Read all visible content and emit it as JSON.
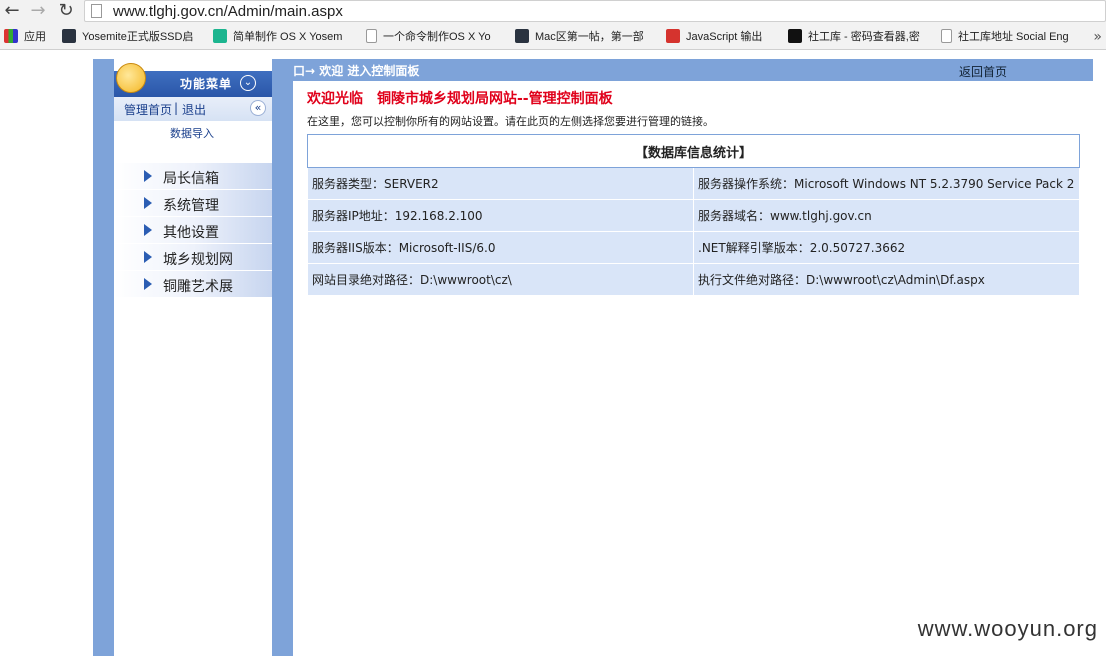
{
  "browser": {
    "url": "www.tlghj.gov.cn/Admin/main.aspx",
    "bookmarks": [
      {
        "label": "应用",
        "icon": "apps-grid-icon"
      },
      {
        "label": "Yosemite正式版SSD启",
        "icon": "app-icon"
      },
      {
        "label": "简单制作 OS X Yosem",
        "icon": "check-icon"
      },
      {
        "label": "一个命令制作OS X Yo",
        "icon": "page-icon"
      },
      {
        "label": "Mac区第一帖，第一部",
        "icon": "app-icon"
      },
      {
        "label": "JavaScript 输出",
        "icon": "w3-icon"
      },
      {
        "label": "社工库 - 密码查看器,密",
        "icon": "pw-icon"
      },
      {
        "label": "社工库地址 Social Eng",
        "icon": "page-icon"
      }
    ]
  },
  "sidebar": {
    "title": "功能菜单",
    "links": {
      "home": "管理首页",
      "sep": "|",
      "logout": "退出"
    },
    "import_label": "数据导入",
    "menu": [
      "局长信箱",
      "系统管理",
      "其他设置",
      "城乡规划网",
      "铜雕艺术展"
    ]
  },
  "main": {
    "breadcrumb": "口→ 欢迎 进入控制面板",
    "back_home": "返回首页",
    "welcome": "欢迎光临　铜陵市城乡规划局网站--管理控制面板",
    "intro": "在这里，您可以控制你所有的网站设置。请在此页的左侧选择您要进行管理的链接。",
    "table": {
      "title": "【数据库信息统计】",
      "rows": [
        [
          "服务器类型：SERVER2",
          "服务器操作系统：Microsoft Windows NT 5.2.3790 Service Pack 2"
        ],
        [
          "服务器IP地址：192.168.2.100",
          "服务器域名：www.tlghj.gov.cn"
        ],
        [
          "服务器IIS版本：Microsoft-IIS/6.0",
          ".NET解释引擎版本：2.0.50727.3662"
        ],
        [
          "网站目录绝对路径：D:\\wwwroot\\cz\\",
          "执行文件绝对路径：D:\\wwwroot\\cz\\Admin\\Df.aspx"
        ]
      ]
    }
  },
  "watermark": "www.wooyun.org",
  "colors": {
    "accent_blue": "#7ea3d9",
    "welcome_red": "#e0001a"
  }
}
